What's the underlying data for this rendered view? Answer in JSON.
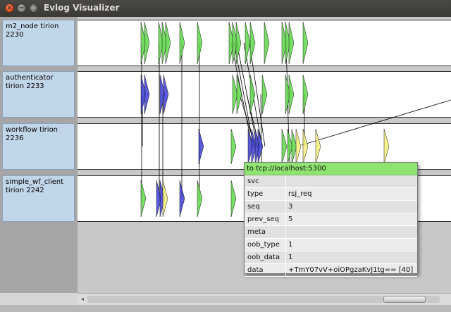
{
  "window": {
    "title": "Evlog Visualizer"
  },
  "titlebar_buttons": {
    "close_glyph": "×",
    "minimize_glyph": "−",
    "maximize_glyph": "□"
  },
  "hosts": [
    {
      "label": "m2_node tirion\n2230"
    },
    {
      "label": "authenticator\ntirion 2233"
    },
    {
      "label": "workflow tirion\n2236"
    },
    {
      "label": "simple_wf_client\ntirion 2242"
    }
  ],
  "colors": {
    "recv": "#5fd84a",
    "send": "#3e3ed2",
    "pending": "#f4ee7a",
    "tooltip_header": "#8fe370",
    "lane_bg": "#ffffff"
  },
  "tooltip": {
    "title": "to tcp://localhost:5300",
    "rows": [
      {
        "key": "svc",
        "value": ""
      },
      {
        "key": "type",
        "value": "rsj_req"
      },
      {
        "key": "seq",
        "value": "3"
      },
      {
        "key": "prev_seq",
        "value": "5"
      },
      {
        "key": "meta",
        "value": ""
      },
      {
        "key": "oob_type",
        "value": "1"
      },
      {
        "key": "oob_data",
        "value": "1"
      },
      {
        "key": "data",
        "value": "+TmY07vV+oiOPgzaKvJ1tg== [40]"
      }
    ]
  },
  "scrollbar": {
    "left_arrow": "◂"
  }
}
